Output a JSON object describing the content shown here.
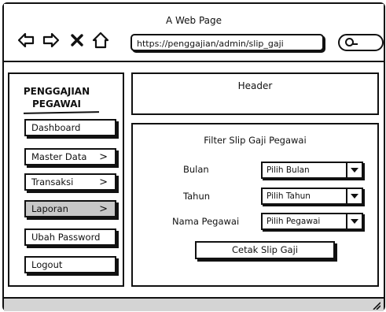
{
  "window": {
    "title": "A Web Page"
  },
  "browser": {
    "url": "https://penggajian/admin/slip_gaji"
  },
  "sidebar": {
    "brand_line1": "PENGGAJIAN",
    "brand_line2": "PEGAWAI",
    "items": [
      {
        "label": "Dashboard",
        "chevron": ""
      },
      {
        "label": "Master Data",
        "chevron": ">"
      },
      {
        "label": "Transaksi",
        "chevron": ">"
      },
      {
        "label": "Laporan",
        "chevron": ">"
      },
      {
        "label": "Ubah Password",
        "chevron": ""
      },
      {
        "label": "Logout",
        "chevron": ""
      }
    ]
  },
  "header": {
    "title": "Header"
  },
  "filter": {
    "title": "Filter Slip Gaji Pegawai",
    "fields": [
      {
        "label": "Bulan",
        "value": "Pilih Bulan"
      },
      {
        "label": "Tahun",
        "value": "Pilih Tahun"
      },
      {
        "label": "Nama Pegawai",
        "value": "Pilih Pegawai"
      }
    ],
    "button_label": "Cetak Slip Gaji"
  },
  "icons": {
    "back": "back-arrow-icon",
    "forward": "forward-arrow-icon",
    "stop": "close-icon",
    "home": "home-icon",
    "search": "search-icon",
    "dropdown": "chevron-down-icon",
    "resize": "resize-grip-icon"
  },
  "colors": {
    "active_menu": "#c8c8c8",
    "statusbar": "#d4d4d4",
    "stroke": "#111111"
  }
}
